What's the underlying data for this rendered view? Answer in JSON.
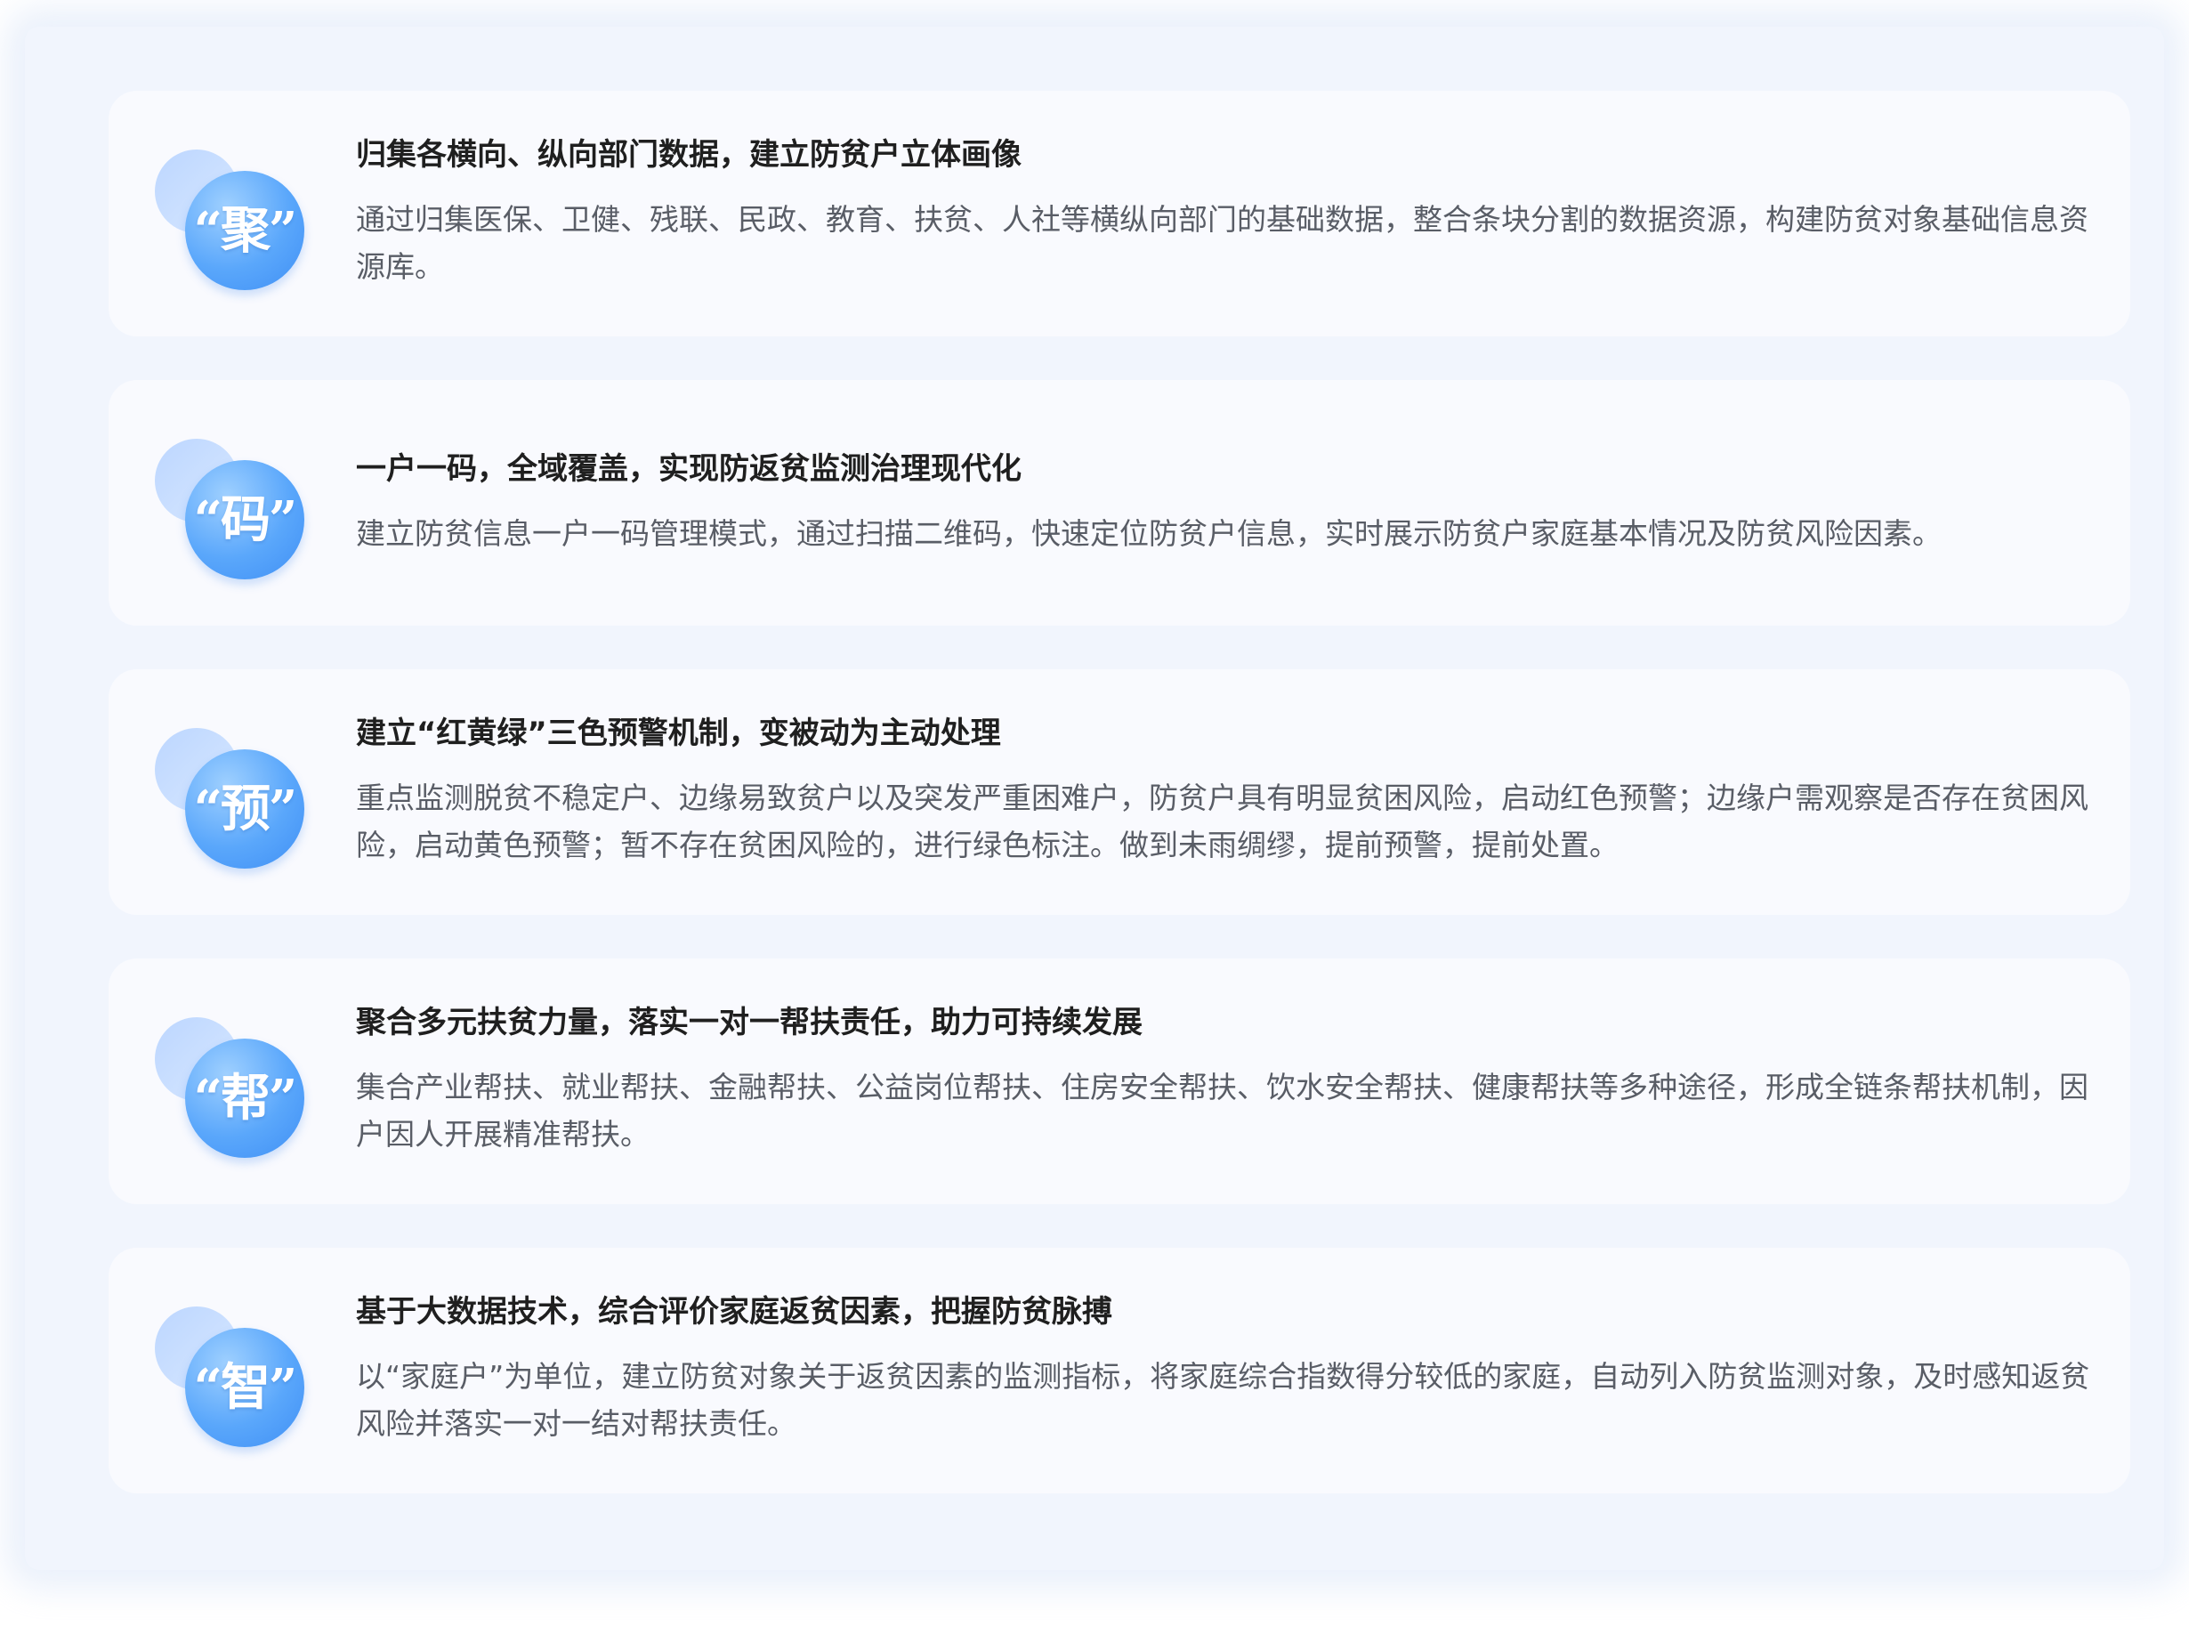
{
  "cards": [
    {
      "badge": "“聚”",
      "title": "归集各横向、纵向部门数据，建立防贫户立体画像",
      "description": "通过归集医保、卫健、残联、民政、教育、扶贫、人社等横纵向部门的基础数据，整合条块分割的数据资源，构建防贫对象基础信息资源库。"
    },
    {
      "badge": "“码”",
      "title": "一户一码，全域覆盖，实现防返贫监测治理现代化",
      "description": "建立防贫信息一户一码管理模式，通过扫描二维码，快速定位防贫户信息，实时展示防贫户家庭基本情况及防贫风险因素。"
    },
    {
      "badge": "“预”",
      "title": "建立“红黄绿”三色预警机制，变被动为主动处理",
      "description": "重点监测脱贫不稳定户、边缘易致贫户以及突发严重困难户，防贫户具有明显贫困风险，启动红色预警；边缘户需观察是否存在贫困风险，启动黄色预警；暂不存在贫困风险的，进行绿色标注。做到未雨绸缪，提前预警，提前处置。"
    },
    {
      "badge": "“帮”",
      "title": "聚合多元扶贫力量，落实一对一帮扶责任，助力可持续发展",
      "description": "集合产业帮扶、就业帮扶、金融帮扶、公益岗位帮扶、住房安全帮扶、饮水安全帮扶、健康帮扶等多种途径，形成全链条帮扶机制，因户因人开展精准帮扶。"
    },
    {
      "badge": "“智”",
      "title": "基于大数据技术，综合评价家庭返贫因素，把握防贫脉搏",
      "description": "以“家庭户”为单位，建立防贫对象关于返贫因素的监测指标，将家庭综合指数得分较低的家庭，自动列入防贫监测对象，及时感知返贫风险并落实一对一结对帮扶责任。"
    }
  ],
  "colors": {
    "panel_bg": "#f1f5fd",
    "card_bg": "#f9fafe",
    "accent_blue": "#5aa7fb",
    "title_text": "#1f1f1f",
    "body_text": "#595d66"
  }
}
